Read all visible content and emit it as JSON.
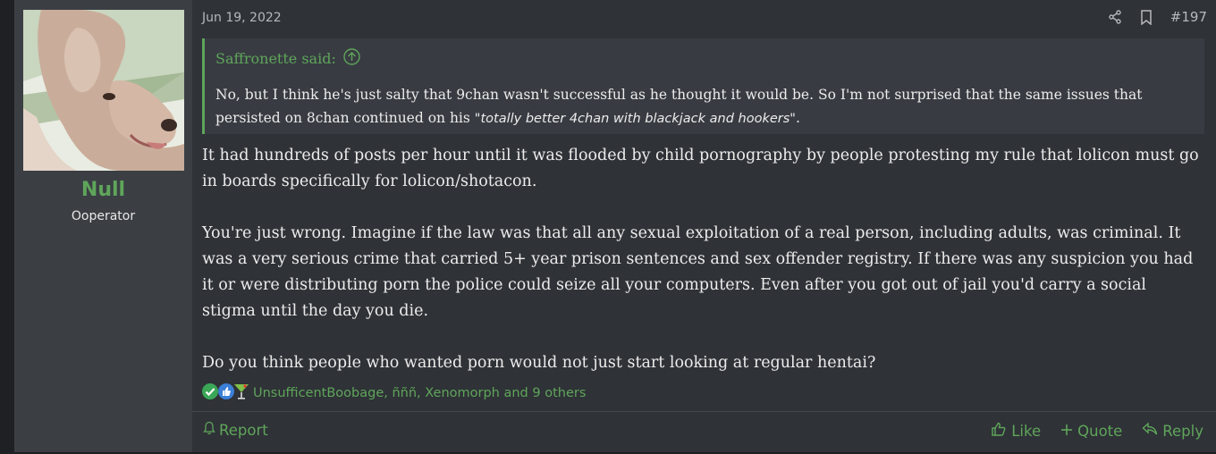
{
  "user": {
    "name": "Null",
    "title": "Ooperator"
  },
  "post": {
    "date": "Jun 19, 2022",
    "number": "#197"
  },
  "quote": {
    "author": "Saffronette said:",
    "text_before": "No, but I think he's just salty that 9chan wasn't successful as he thought it would be. So I'm not surprised that the same issues that persisted on 8chan continued on his ",
    "text_italic": "\"totally better 4chan with blackjack and hookers\"",
    "text_after": "."
  },
  "body": {
    "p1": "It had hundreds of posts per hour until it was flooded by child pornography by people protesting my rule that lolicon must go in boards specifically for lolicon/shotacon.",
    "p2": "You're just wrong. Imagine if the law was that all any sexual exploitation of a real person, including adults, was criminal. It was a very serious crime that carried 5+ year prison sentences and sex offender registry. If there was any suspicion you had it or were distributing porn the police could seize all your computers. Even after you got out of jail you'd carry a social stigma until the day you die.",
    "p3": "Do you think people who wanted porn would not just start looking at regular hentai?"
  },
  "reactions": {
    "icons": [
      "checkmark-icon",
      "thumbs-up-icon",
      "cocktail-icon"
    ],
    "text": "UnsufficentBoobage, ñññ, Xenomorph and 9 others"
  },
  "footer": {
    "report": "Report",
    "like": "Like",
    "quote": "Quote",
    "reply": "Reply"
  },
  "colors": {
    "accent": "#5fa55a",
    "background": "#2f3237",
    "sidebar": "#3b3f44"
  }
}
